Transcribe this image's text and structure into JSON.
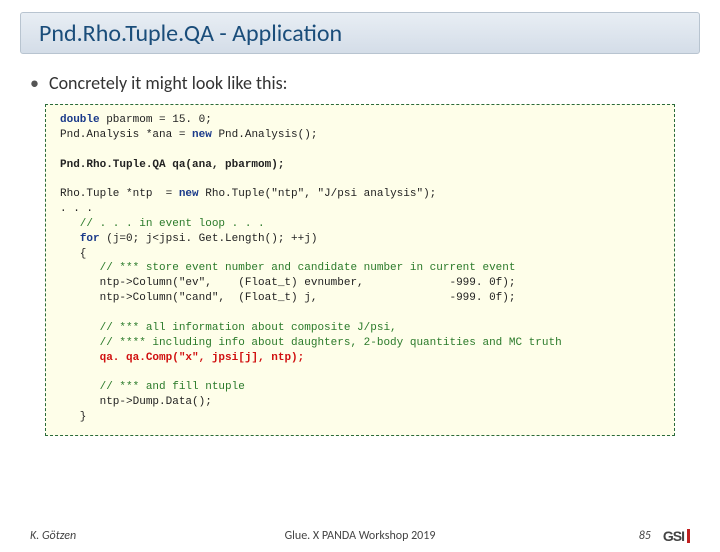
{
  "title": "Pnd.Rho.Tuple.QA - Application",
  "bullet": "Concretely it might look like this:",
  "code": {
    "l1a": "double",
    "l1b": " pbarmom = 15. 0;",
    "l2a": "Pnd.Analysis *ana = ",
    "l2b": "new",
    "l2c": " Pnd.Analysis();",
    "l3": "Pnd.Rho.Tuple.QA qa(ana, pbarmom);",
    "l4a": "Rho.Tuple *ntp  = ",
    "l4b": "new",
    "l4c": " Rho.Tuple(\"ntp\", \"J/psi analysis\");",
    "l5": ". . .",
    "l6": "   // . . . in event loop . . .",
    "l7a": "   ",
    "l7b": "for",
    "l7c": " (j=0; j<jpsi. Get.Length(); ++j)",
    "l8": "   {",
    "l9": "      // *** store event number and candidate number in current event",
    "l10": "      ntp->Column(\"ev\",    (Float_t) evnumber,             -999. 0f);",
    "l11": "      ntp->Column(\"cand\",  (Float_t) j,                    -999. 0f);",
    "l12": "      // *** all information about composite J/psi,",
    "l13": "      // **** including info about daughters, 2-body quantities and MC truth",
    "l14a": "      ",
    "l14b": "qa. qa.Comp(\"x\", jpsi[j], ntp);",
    "l15": "      // *** and fill ntuple",
    "l16": "      ntp->Dump.Data();",
    "l17": "   }"
  },
  "footer": {
    "author": "K. Götzen",
    "event": "Glue. X PANDA Workshop 2019",
    "page": "85",
    "logo": "GSI"
  }
}
